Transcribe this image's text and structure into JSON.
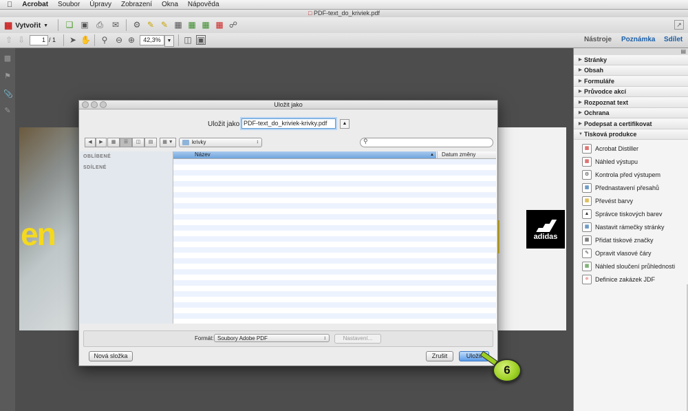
{
  "menubar": {
    "app": "Acrobat",
    "items": [
      "Soubor",
      "Úpravy",
      "Zobrazení",
      "Okna",
      "Nápověda"
    ]
  },
  "window": {
    "title": "PDF-text_do_kriviek.pdf"
  },
  "toolbar": {
    "create_label": "Vytvořit"
  },
  "nav": {
    "page_current": "1",
    "page_total": "/ 1",
    "zoom": "42,3%"
  },
  "right_tabs": [
    "Nástroje",
    "Poznámka",
    "Sdílet"
  ],
  "panel": {
    "sections": [
      "Stránky",
      "Obsah",
      "Formuláře",
      "Průvodce akcí",
      "Rozpoznat text",
      "Ochrana",
      "Podepsat a certifikovat",
      "Tisková produkce"
    ],
    "tools": [
      "Acrobat Distiller",
      "Náhled výstupu",
      "Kontrola před výstupem",
      "Přednastavení přesahů",
      "Převést barvy",
      "Správce tiskových barev",
      "Nastavit rámečky stránky",
      "Přidat tiskové značky",
      "Opravit vlasové čáry",
      "Náhled sloučení průhlednosti",
      "Definice zakázek JDF"
    ]
  },
  "document": {
    "logo_word": "adidas",
    "big_text": "en"
  },
  "dialog": {
    "title": "Uložit jako",
    "save_as_label": "Uložit jako:",
    "filename": "PDF-text_do_kriviek-krivky.pdf",
    "folder": "krivky",
    "sidebar": {
      "favorites": "OBLÍBENÉ",
      "shared": "SDÍLENÉ"
    },
    "columns": {
      "name": "Název",
      "date": "Datum změny"
    },
    "format_label": "Formát:",
    "format_value": "Soubory Adobe PDF",
    "settings_button": "Nastavení...",
    "new_folder_button": "Nová složka",
    "cancel_button": "Zrušit",
    "save_button": "Uložit"
  },
  "callout": {
    "number": "6"
  },
  "colors": {
    "accent": "#5b9cea",
    "callout": "#9ccf23",
    "logo_yellow": "#f4d91e"
  }
}
